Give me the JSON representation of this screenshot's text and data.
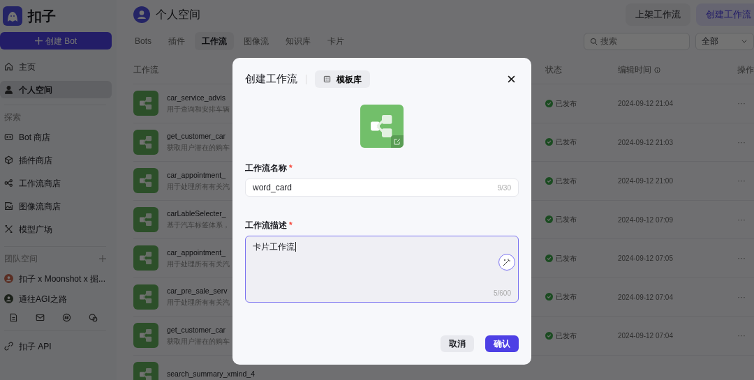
{
  "sidebar": {
    "logo_text": "扣子",
    "create_button": "创建 Bot",
    "nav": [
      {
        "label": "主页",
        "selected": false
      },
      {
        "label": "个人空间",
        "selected": true
      }
    ],
    "explore_title": "探索",
    "explore": [
      {
        "label": "Bot 商店"
      },
      {
        "label": "插件商店"
      },
      {
        "label": "工作流商店"
      },
      {
        "label": "图像流商店"
      },
      {
        "label": "模型广场"
      }
    ],
    "team_title": "团队空间",
    "teams": [
      {
        "label": "扣子 x Moonshot x 掘..."
      },
      {
        "label": "通往AGI之路"
      }
    ],
    "bottom": [
      {
        "label": "扣子 API"
      }
    ]
  },
  "header": {
    "title": "个人空间",
    "buttons": [
      "上架工作流",
      "创建工作流"
    ],
    "tabs": [
      {
        "label": "Bots",
        "selected": false
      },
      {
        "label": "插件",
        "selected": false
      },
      {
        "label": "工作流",
        "selected": true
      },
      {
        "label": "图像流",
        "selected": false
      },
      {
        "label": "知识库",
        "selected": false
      },
      {
        "label": "卡片",
        "selected": false
      }
    ],
    "search": {
      "placeholder": "搜索"
    },
    "filter": "全部"
  },
  "table": {
    "columns": [
      "工作流",
      "状态",
      "编辑时间",
      "操作"
    ],
    "rows": [
      {
        "name": "car_service_advis",
        "description": "用于查询和安排车辆",
        "status": "已发布",
        "time": "2024-09-12 21:04",
        "menu": "···"
      },
      {
        "name": "get_customer_car",
        "description": "获取用户潜在的购车",
        "status": "已发布",
        "time": "2024-09-12 21:03",
        "menu": "···"
      },
      {
        "name": "car_appointment_",
        "description": "用于处理所有有关汽",
        "status": "已发布",
        "time": "2024-09-12 21:00",
        "menu": "···"
      },
      {
        "name": "carLableSelecter_",
        "description": "基于汽车标签体系，",
        "status": "已发布",
        "time": "2024-09-12 07:09",
        "menu": "···"
      },
      {
        "name": "car_appointment_",
        "description": "用于处理所有有关汽",
        "status": "已发布",
        "time": "2024-09-12 07:05",
        "menu": "···"
      },
      {
        "name": "car_pre_sale_serv",
        "description": "用于处理所有有关汽",
        "status": "已发布",
        "time": "2024-09-12 07:04",
        "menu": "···"
      },
      {
        "name": "get_customer_car",
        "description": "获取用户潜在的购车",
        "status": "已发布",
        "time": "2024-09-12 07:04",
        "menu": "···"
      },
      {
        "name": "search_summary_xmind_4"
      }
    ]
  },
  "modal": {
    "title": "创建工作流",
    "template_button": "模板库",
    "name_field": {
      "label": "工作流名称",
      "mark": "*",
      "value": "word_card",
      "count": "9/30",
      "focused": false
    },
    "desc_field": {
      "label": "工作流描述",
      "mark": "*",
      "value": "卡片工作流",
      "count": "5/600",
      "focused": true
    },
    "buttons": [
      {
        "label": "取消",
        "kind": "secondary"
      },
      {
        "label": "确认",
        "kind": "primary"
      }
    ]
  }
}
